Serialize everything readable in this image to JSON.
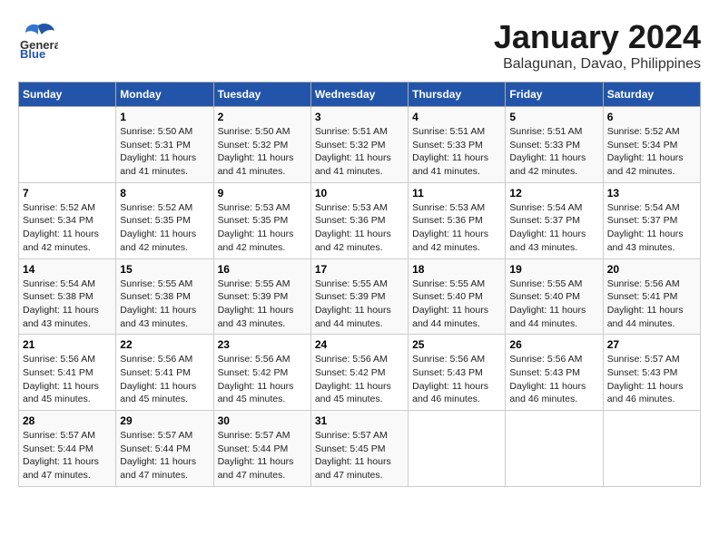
{
  "header": {
    "logo_general": "General",
    "logo_blue": "Blue",
    "title": "January 2024",
    "subtitle": "Balagunan, Davao, Philippines"
  },
  "weekdays": [
    "Sunday",
    "Monday",
    "Tuesday",
    "Wednesday",
    "Thursday",
    "Friday",
    "Saturday"
  ],
  "weeks": [
    [
      {
        "date": "",
        "sunrise": "",
        "sunset": "",
        "daylight": ""
      },
      {
        "date": "1",
        "sunrise": "5:50 AM",
        "sunset": "5:31 PM",
        "daylight": "11 hours and 41 minutes."
      },
      {
        "date": "2",
        "sunrise": "5:50 AM",
        "sunset": "5:32 PM",
        "daylight": "11 hours and 41 minutes."
      },
      {
        "date": "3",
        "sunrise": "5:51 AM",
        "sunset": "5:32 PM",
        "daylight": "11 hours and 41 minutes."
      },
      {
        "date": "4",
        "sunrise": "5:51 AM",
        "sunset": "5:33 PM",
        "daylight": "11 hours and 41 minutes."
      },
      {
        "date": "5",
        "sunrise": "5:51 AM",
        "sunset": "5:33 PM",
        "daylight": "11 hours and 42 minutes."
      },
      {
        "date": "6",
        "sunrise": "5:52 AM",
        "sunset": "5:34 PM",
        "daylight": "11 hours and 42 minutes."
      }
    ],
    [
      {
        "date": "7",
        "sunrise": "5:52 AM",
        "sunset": "5:34 PM",
        "daylight": "11 hours and 42 minutes."
      },
      {
        "date": "8",
        "sunrise": "5:52 AM",
        "sunset": "5:35 PM",
        "daylight": "11 hours and 42 minutes."
      },
      {
        "date": "9",
        "sunrise": "5:53 AM",
        "sunset": "5:35 PM",
        "daylight": "11 hours and 42 minutes."
      },
      {
        "date": "10",
        "sunrise": "5:53 AM",
        "sunset": "5:36 PM",
        "daylight": "11 hours and 42 minutes."
      },
      {
        "date": "11",
        "sunrise": "5:53 AM",
        "sunset": "5:36 PM",
        "daylight": "11 hours and 42 minutes."
      },
      {
        "date": "12",
        "sunrise": "5:54 AM",
        "sunset": "5:37 PM",
        "daylight": "11 hours and 43 minutes."
      },
      {
        "date": "13",
        "sunrise": "5:54 AM",
        "sunset": "5:37 PM",
        "daylight": "11 hours and 43 minutes."
      }
    ],
    [
      {
        "date": "14",
        "sunrise": "5:54 AM",
        "sunset": "5:38 PM",
        "daylight": "11 hours and 43 minutes."
      },
      {
        "date": "15",
        "sunrise": "5:55 AM",
        "sunset": "5:38 PM",
        "daylight": "11 hours and 43 minutes."
      },
      {
        "date": "16",
        "sunrise": "5:55 AM",
        "sunset": "5:39 PM",
        "daylight": "11 hours and 43 minutes."
      },
      {
        "date": "17",
        "sunrise": "5:55 AM",
        "sunset": "5:39 PM",
        "daylight": "11 hours and 44 minutes."
      },
      {
        "date": "18",
        "sunrise": "5:55 AM",
        "sunset": "5:40 PM",
        "daylight": "11 hours and 44 minutes."
      },
      {
        "date": "19",
        "sunrise": "5:55 AM",
        "sunset": "5:40 PM",
        "daylight": "11 hours and 44 minutes."
      },
      {
        "date": "20",
        "sunrise": "5:56 AM",
        "sunset": "5:41 PM",
        "daylight": "11 hours and 44 minutes."
      }
    ],
    [
      {
        "date": "21",
        "sunrise": "5:56 AM",
        "sunset": "5:41 PM",
        "daylight": "11 hours and 45 minutes."
      },
      {
        "date": "22",
        "sunrise": "5:56 AM",
        "sunset": "5:41 PM",
        "daylight": "11 hours and 45 minutes."
      },
      {
        "date": "23",
        "sunrise": "5:56 AM",
        "sunset": "5:42 PM",
        "daylight": "11 hours and 45 minutes."
      },
      {
        "date": "24",
        "sunrise": "5:56 AM",
        "sunset": "5:42 PM",
        "daylight": "11 hours and 45 minutes."
      },
      {
        "date": "25",
        "sunrise": "5:56 AM",
        "sunset": "5:43 PM",
        "daylight": "11 hours and 46 minutes."
      },
      {
        "date": "26",
        "sunrise": "5:56 AM",
        "sunset": "5:43 PM",
        "daylight": "11 hours and 46 minutes."
      },
      {
        "date": "27",
        "sunrise": "5:57 AM",
        "sunset": "5:43 PM",
        "daylight": "11 hours and 46 minutes."
      }
    ],
    [
      {
        "date": "28",
        "sunrise": "5:57 AM",
        "sunset": "5:44 PM",
        "daylight": "11 hours and 47 minutes."
      },
      {
        "date": "29",
        "sunrise": "5:57 AM",
        "sunset": "5:44 PM",
        "daylight": "11 hours and 47 minutes."
      },
      {
        "date": "30",
        "sunrise": "5:57 AM",
        "sunset": "5:44 PM",
        "daylight": "11 hours and 47 minutes."
      },
      {
        "date": "31",
        "sunrise": "5:57 AM",
        "sunset": "5:45 PM",
        "daylight": "11 hours and 47 minutes."
      },
      {
        "date": "",
        "sunrise": "",
        "sunset": "",
        "daylight": ""
      },
      {
        "date": "",
        "sunrise": "",
        "sunset": "",
        "daylight": ""
      },
      {
        "date": "",
        "sunrise": "",
        "sunset": "",
        "daylight": ""
      }
    ]
  ]
}
